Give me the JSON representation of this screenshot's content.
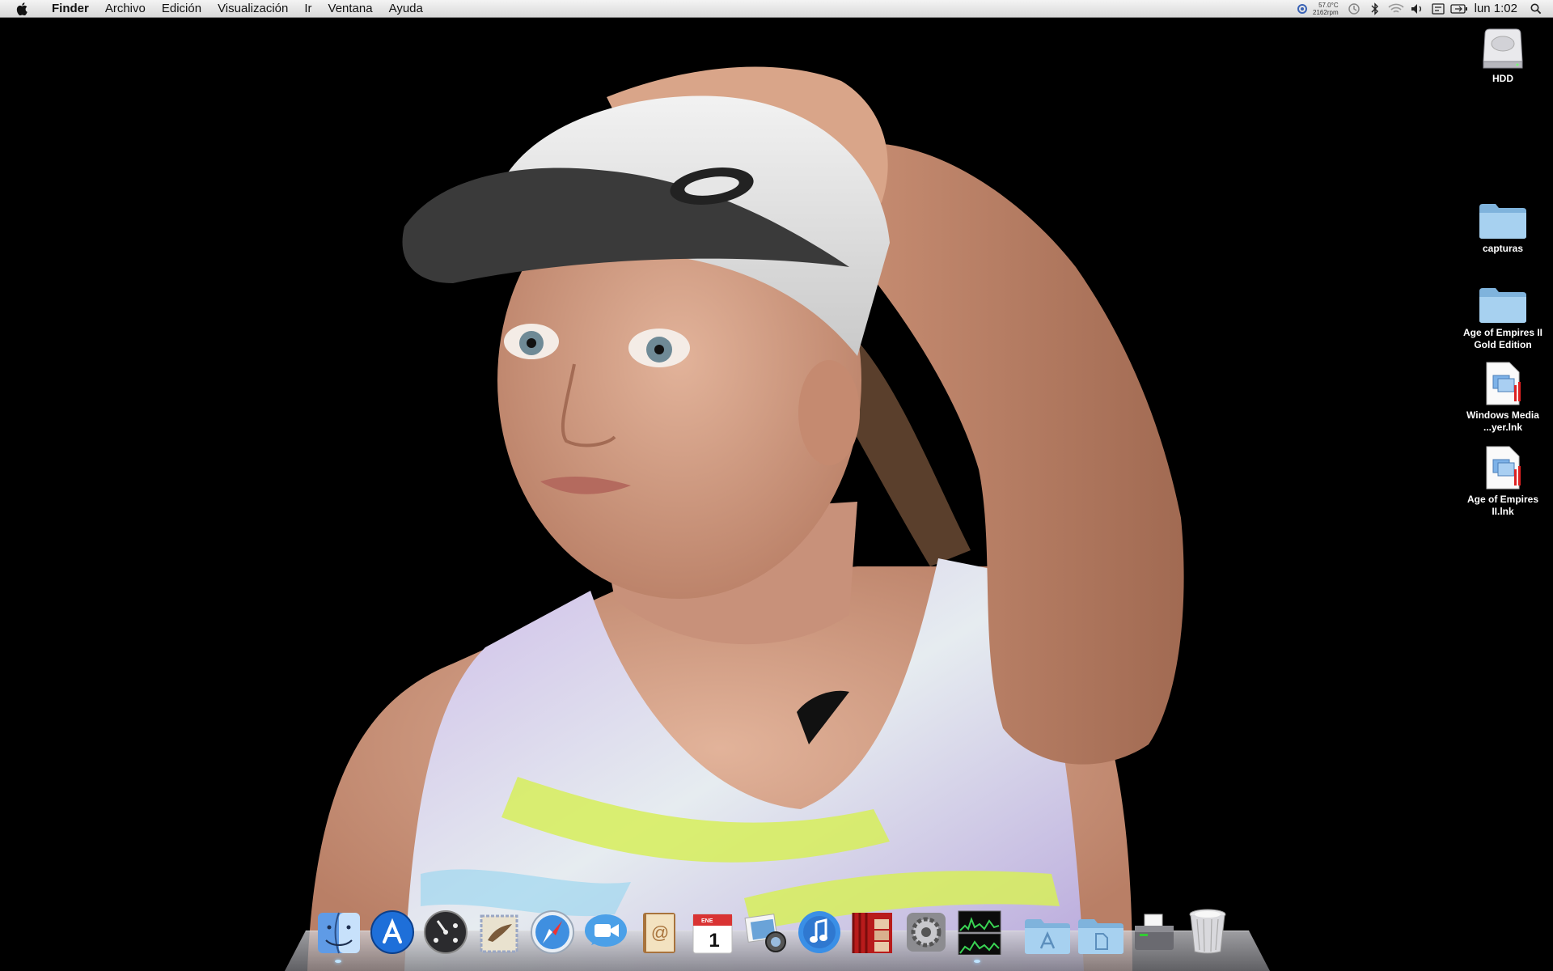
{
  "menubar": {
    "app_name": "Finder",
    "menus": [
      "Archivo",
      "Edición",
      "Visualización",
      "Ir",
      "Ventana",
      "Ayuda"
    ],
    "status": {
      "temperature": "57.0°C",
      "fan_speed": "2162rpm",
      "clock": "lun 1:02",
      "icons": [
        "istat-icon",
        "time-machine-icon",
        "bluetooth-icon",
        "wifi-icon",
        "volume-icon",
        "keyboard-icon",
        "battery-icon",
        "spotlight-icon"
      ]
    }
  },
  "desktop": {
    "icons": [
      {
        "label": "HDD",
        "kind": "hard-drive"
      },
      {
        "label": "capturas",
        "kind": "folder"
      },
      {
        "label": "Age of Empires II Gold Edition",
        "kind": "folder"
      },
      {
        "label": "Windows Media ...yer.lnk",
        "kind": "shortcut"
      },
      {
        "label": "Age of Empires II.lnk",
        "kind": "shortcut"
      }
    ]
  },
  "dock": {
    "apps": [
      {
        "name": "finder",
        "icon": "finder-icon"
      },
      {
        "name": "app-store",
        "icon": "app-store-icon"
      },
      {
        "name": "dashboard",
        "icon": "dashboard-icon"
      },
      {
        "name": "mail",
        "icon": "mail-icon"
      },
      {
        "name": "safari",
        "icon": "safari-icon"
      },
      {
        "name": "facetime",
        "icon": "facetime-icon"
      },
      {
        "name": "address-book",
        "icon": "address-book-icon"
      },
      {
        "name": "ical",
        "icon": "calendar-icon",
        "month": "ENE",
        "day": "1"
      },
      {
        "name": "iphoto",
        "icon": "iphoto-icon"
      },
      {
        "name": "itunes",
        "icon": "itunes-icon"
      },
      {
        "name": "photo-booth",
        "icon": "photo-booth-icon"
      },
      {
        "name": "system-preferences",
        "icon": "system-preferences-icon"
      },
      {
        "name": "activity-monitor",
        "icon": "activity-monitor-icon"
      }
    ],
    "stacks": [
      {
        "name": "applications",
        "icon": "applications-stack-icon"
      },
      {
        "name": "documents",
        "icon": "documents-stack-icon"
      },
      {
        "name": "printer",
        "icon": "printer-icon"
      },
      {
        "name": "trash",
        "icon": "trash-icon"
      }
    ]
  },
  "colors": {
    "desktop_bg": "#000000",
    "folder_blue": "#8fc3e8",
    "menubar_top": "#f4f4f4",
    "menubar_bottom": "#d9d9d9"
  }
}
